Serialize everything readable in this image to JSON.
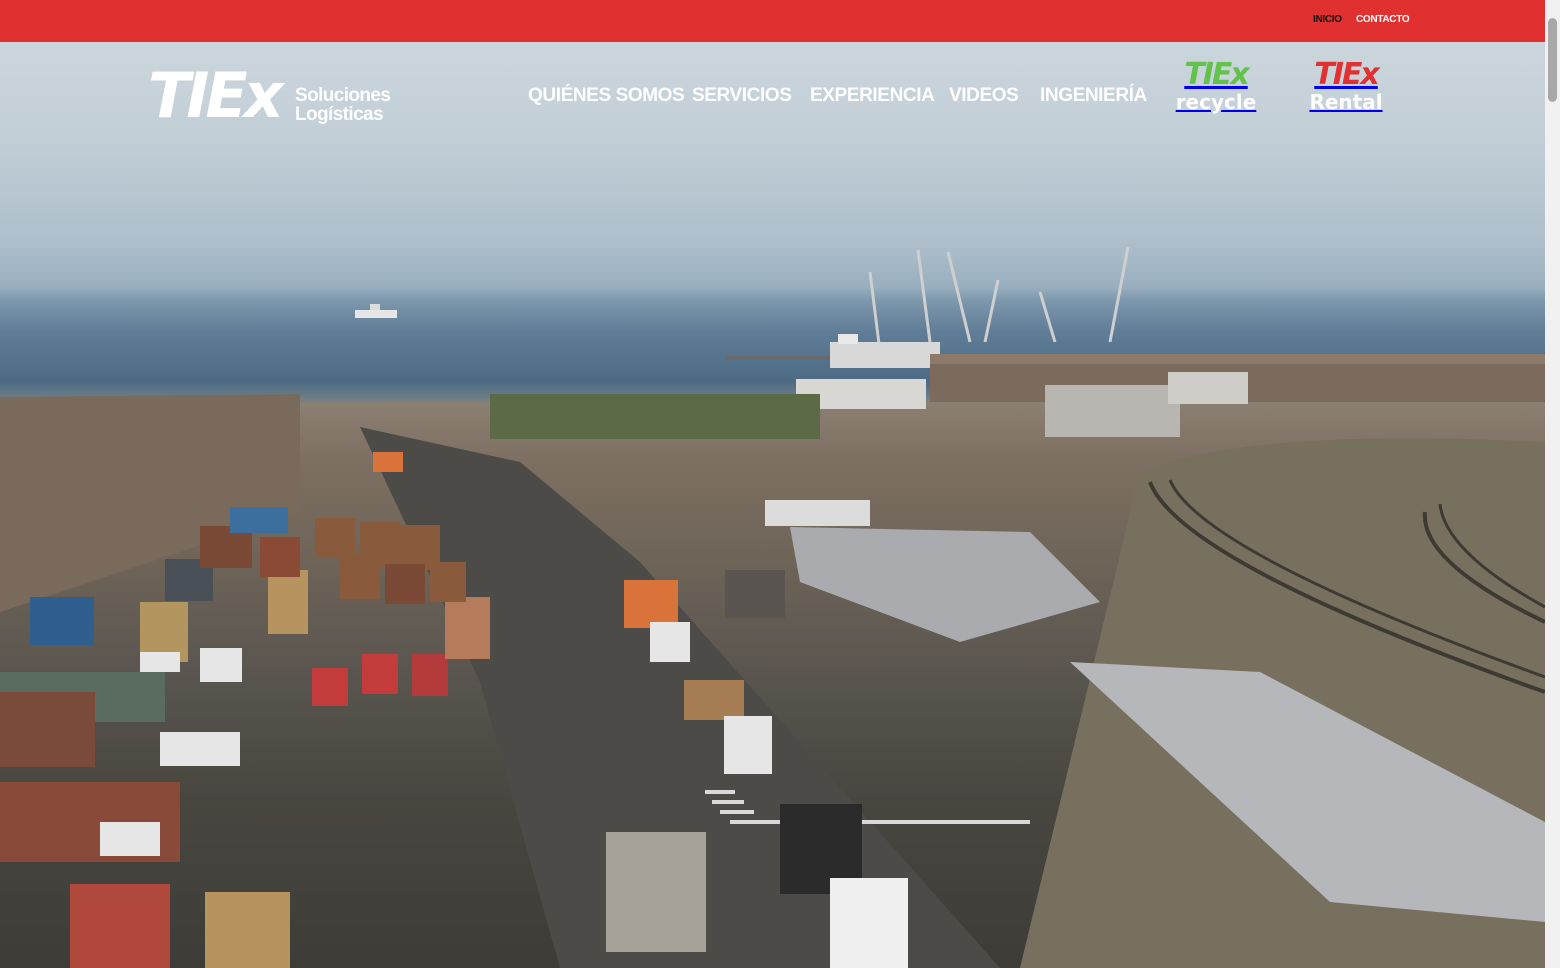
{
  "topbar": {
    "inicio": "INICIO",
    "contacto": "CONTACTO",
    "color": "#e0302f"
  },
  "logo": {
    "mark": "TIEx",
    "line1": "Soluciones",
    "line2": "Logísticas"
  },
  "nav": [
    "QUIÉNES SOMOS",
    "SERVICIOS",
    "EXPERIENCIA",
    "VIDEOS",
    "INGENIERÍA"
  ],
  "brands": {
    "recycle": {
      "mark": "TIEx",
      "sub": "recycle",
      "color": "#62c24a"
    },
    "rental": {
      "mark": "TIEx",
      "sub": "Rental",
      "color": "#e0302f"
    }
  }
}
